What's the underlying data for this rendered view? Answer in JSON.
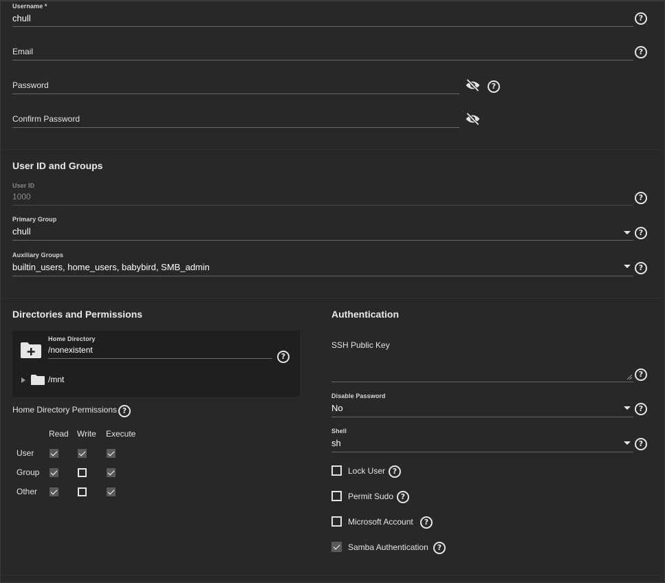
{
  "credentials": {
    "username_label": "Username *",
    "username_value": "chull",
    "email_label": "Email",
    "password_label": "Password",
    "confirm_password_label": "Confirm Password"
  },
  "user_id_groups": {
    "title": "User ID and Groups",
    "user_id_label": "User ID",
    "user_id_value": "1000",
    "primary_group_label": "Primary Group",
    "primary_group_value": "chull",
    "auxiliary_groups_label": "Auxiliary Groups",
    "auxiliary_groups_value": "builtin_users, home_users, babybird, SMB_admin"
  },
  "directories": {
    "title": "Directories and Permissions",
    "home_directory_label": "Home Directory",
    "home_directory_value": "/nonexistent",
    "tree_node": "/mnt",
    "permissions_label": "Home Directory Permissions",
    "columns": [
      "Read",
      "Write",
      "Execute"
    ],
    "rows": [
      {
        "label": "User",
        "read": true,
        "write": true,
        "execute": true
      },
      {
        "label": "Group",
        "read": true,
        "write": false,
        "execute": true
      },
      {
        "label": "Other",
        "read": true,
        "write": false,
        "execute": true
      }
    ]
  },
  "authentication": {
    "title": "Authentication",
    "ssh_key_label": "SSH Public Key",
    "disable_password_label": "Disable Password",
    "disable_password_value": "No",
    "shell_label": "Shell",
    "shell_value": "sh",
    "options": [
      {
        "label": "Lock User",
        "checked": false
      },
      {
        "label": "Permit Sudo",
        "checked": false
      },
      {
        "label": "Microsoft Account",
        "checked": false
      },
      {
        "label": "Samba Authentication",
        "checked": true
      }
    ]
  },
  "icons": {
    "help": "help-circle-icon",
    "visibility_off": "eye-off-icon",
    "dropdown": "caret-down-icon",
    "new_folder": "folder-plus-icon",
    "folder": "folder-icon",
    "expand": "triangle-right-icon"
  },
  "colors": {
    "background": "#282828",
    "panel": "#1f1f1f",
    "text": "#e0e0e0",
    "underline": "#6a6a6a"
  }
}
